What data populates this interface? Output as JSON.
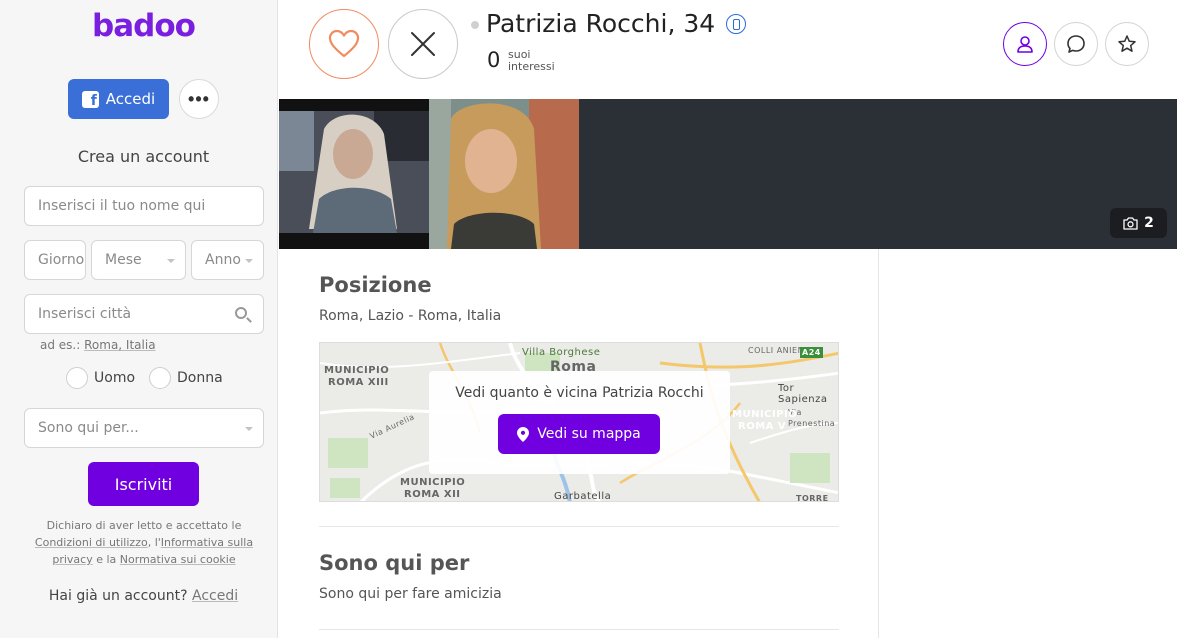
{
  "sidebar": {
    "logo": "badoo",
    "facebook_login_label": "Accedi",
    "more_label": "•••",
    "create_account_title": "Crea un account",
    "name_placeholder": "Inserisci il tuo nome qui",
    "day_placeholder": "Giorno",
    "month_placeholder": "Mese",
    "year_placeholder": "Anno",
    "city_placeholder": "Inserisci città",
    "example_prefix": "ad es.:",
    "example_city": "Roma, Italia",
    "gender_male": "Uomo",
    "gender_female": "Donna",
    "purpose_placeholder": "Sono qui per...",
    "signup_label": "Iscriviti",
    "legal_part1": "Dichiaro di aver letto e accettato le",
    "legal_terms": "Condizioni di utilizzo",
    "legal_part2": ", l'",
    "legal_privacy": "Informativa sulla privacy",
    "legal_part3": " e la ",
    "legal_cookie": "Normativa sui cookie",
    "have_account": "Hai già un account?",
    "login_link": "Accedi"
  },
  "profile": {
    "name_age": "Patrizia Rocchi, 34",
    "interests_count": "0",
    "interests_label_line1": "suoi",
    "interests_label_line2": "interessi",
    "photo_count": "2"
  },
  "location": {
    "title": "Posizione",
    "place": "Roma, Lazio - Roma, Italia",
    "map_overlay_text": "Vedi quanto è vicina Patrizia Rocchi",
    "map_button": "Vedi su mappa",
    "map_labels": {
      "villa_borghese": "Villa Borghese",
      "roma": "Roma",
      "colli_aniene": "COLLI ANIENE",
      "a24": "A24",
      "municipio_xiii_1": "MUNICIPIO",
      "municipio_xiii_2": "ROMA XIII",
      "tor_sapienza": "Tor Sapienza",
      "via_prenestina": "Via Prenestina",
      "municipio_v_1": "MUNICIPIO",
      "municipio_v_2": "ROMA V",
      "via_aurelia": "Via Aurelia",
      "municipio_xii_1": "MUNICIPIO",
      "municipio_xii_2": "ROMA XII",
      "garbatella": "Garbatella",
      "torre_maura": "TORRE MAURA"
    }
  },
  "purpose": {
    "title": "Sono qui per",
    "value": "Sono qui per fare amicizia"
  },
  "colors": {
    "brand": "#7000e0",
    "facebook": "#3b6fd8",
    "like": "#f28a60",
    "verified": "#2a6bd6"
  }
}
